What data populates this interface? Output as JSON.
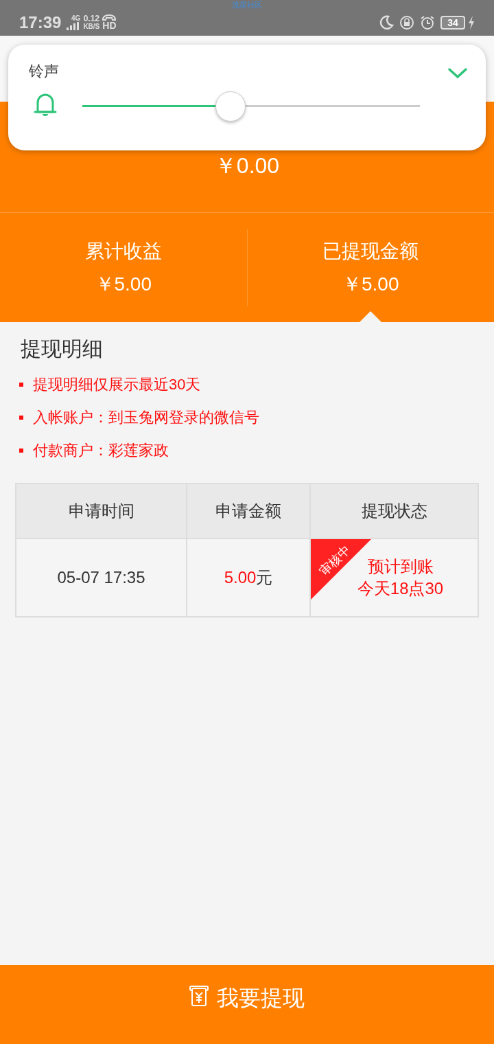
{
  "status_bar": {
    "carrier_note": "流星社区",
    "time": "17:39",
    "network": "4G",
    "speed_value": "0.12",
    "speed_unit": "KB/S",
    "hd": "HD",
    "battery": "34",
    "charging": true
  },
  "volume_panel": {
    "label": "铃声",
    "level": 0.44
  },
  "balance": {
    "amount": "￥0.00"
  },
  "stats": [
    {
      "label": "累计收益",
      "value": "￥5.00",
      "selected": false
    },
    {
      "label": "已提现金额",
      "value": "￥5.00",
      "selected": true
    }
  ],
  "details": {
    "title": "提现明细",
    "notes": [
      "提现明细仅展示最近30天",
      "入帐账户：到玉兔网登录的微信号",
      "付款商户：彩莲家政"
    ]
  },
  "table": {
    "columns": [
      "申请时间",
      "申请金额",
      "提现状态"
    ],
    "rows": [
      {
        "time": "05-07 17:35",
        "amount": "5.00",
        "unit": "元",
        "badge": "审核中",
        "status_lines": [
          "预计到账",
          "今天18点30"
        ]
      }
    ]
  },
  "withdraw_button": {
    "label": "我要提现"
  }
}
